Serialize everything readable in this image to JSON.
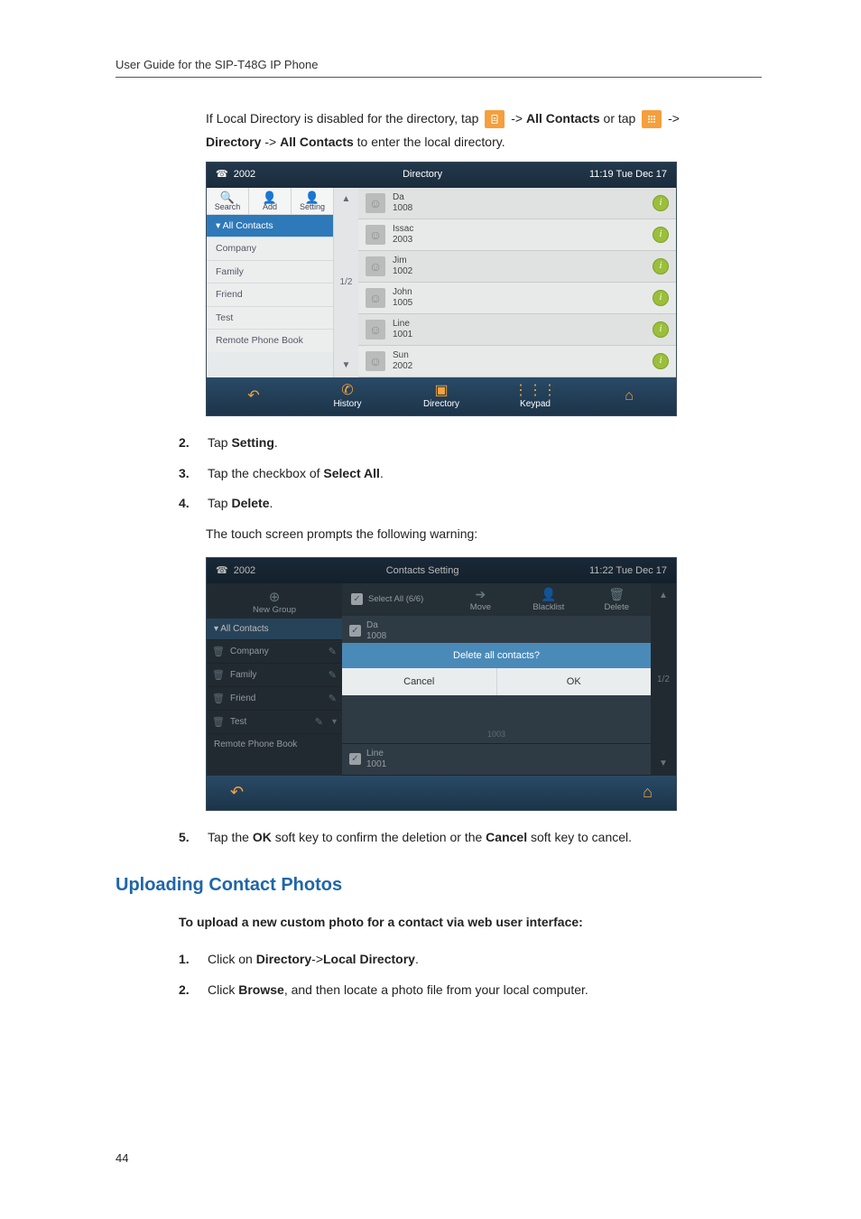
{
  "running_head": "User Guide for the SIP-T48G IP Phone",
  "page_number": "44",
  "intro": {
    "line1_a": "If Local Directory is disabled for the directory, tap ",
    "line1_b": " ->",
    "line1_c_bold": "All Contacts",
    "line1_d": " or tap ",
    "line1_e": " ->",
    "line2_a_bold": "Directory",
    "line2_b": " ->",
    "line2_c_bold": "All Contacts",
    "line2_d": " to enter the local directory."
  },
  "shot1": {
    "status_ext": "2002",
    "status_title": "Directory",
    "status_time": "11:19 Tue Dec 17",
    "side_btn_search": "Search",
    "side_btn_add": "Add",
    "side_btn_setting": "Setting",
    "groups": [
      "All Contacts",
      "Company",
      "Family",
      "Friend",
      "Test",
      "Remote Phone Book"
    ],
    "pager_label": "1/2",
    "contacts": [
      {
        "name": "Da",
        "num": "1008"
      },
      {
        "name": "Issac",
        "num": "2003"
      },
      {
        "name": "Jim",
        "num": "1002"
      },
      {
        "name": "John",
        "num": "1005"
      },
      {
        "name": "Line",
        "num": "1001"
      },
      {
        "name": "Sun",
        "num": "2002"
      }
    ],
    "soft": {
      "back": "",
      "history": "History",
      "directory": "Directory",
      "keypad": "Keypad",
      "home": ""
    }
  },
  "steps_a": [
    {
      "n": "2.",
      "pre": "Tap ",
      "bold": "Setting",
      "post": "."
    },
    {
      "n": "3.",
      "pre": "Tap the checkbox of ",
      "bold": "Select All",
      "post": "."
    },
    {
      "n": "4.",
      "pre": "Tap ",
      "bold": "Delete",
      "post": "."
    }
  ],
  "warning_line": "The touch screen prompts the following warning:",
  "shot2": {
    "status_ext": "2002",
    "status_title": "Contacts Setting",
    "status_time": "11:22 Tue Dec 17",
    "newgroup": "New Group",
    "selectall": "Select All (6/6)",
    "actions": {
      "move": "Move",
      "blacklist": "Blacklist",
      "delete": "Delete"
    },
    "all_contacts": "All Contacts",
    "groups": [
      "Company",
      "Family",
      "Friend",
      "Test",
      "Remote Phone Book"
    ],
    "rows": [
      {
        "name": "Da",
        "num": "1008"
      },
      {
        "name": "Line",
        "num": "1001"
      }
    ],
    "row_hidden_num": "1003",
    "pager_label": "1/2",
    "modal_title": "Delete all contacts?",
    "modal_cancel": "Cancel",
    "modal_ok": "OK"
  },
  "step5": {
    "n": "5.",
    "pre": "Tap the ",
    "b1": "OK",
    "mid": " soft key to confirm the deletion or the ",
    "b2": "Cancel",
    "post": " soft key to cancel."
  },
  "section_title": "Uploading Contact Photos",
  "upload_intro": "To upload a new custom photo for a contact via web user interface:",
  "steps_b": [
    {
      "n": "1.",
      "pre": "Click on ",
      "b1": "Directory",
      "mid": "->",
      "b2": "Local Directory",
      "post": "."
    },
    {
      "n": "2.",
      "pre": "Click ",
      "b1": "Browse",
      "post": ", and then locate a photo file from your local computer."
    }
  ]
}
